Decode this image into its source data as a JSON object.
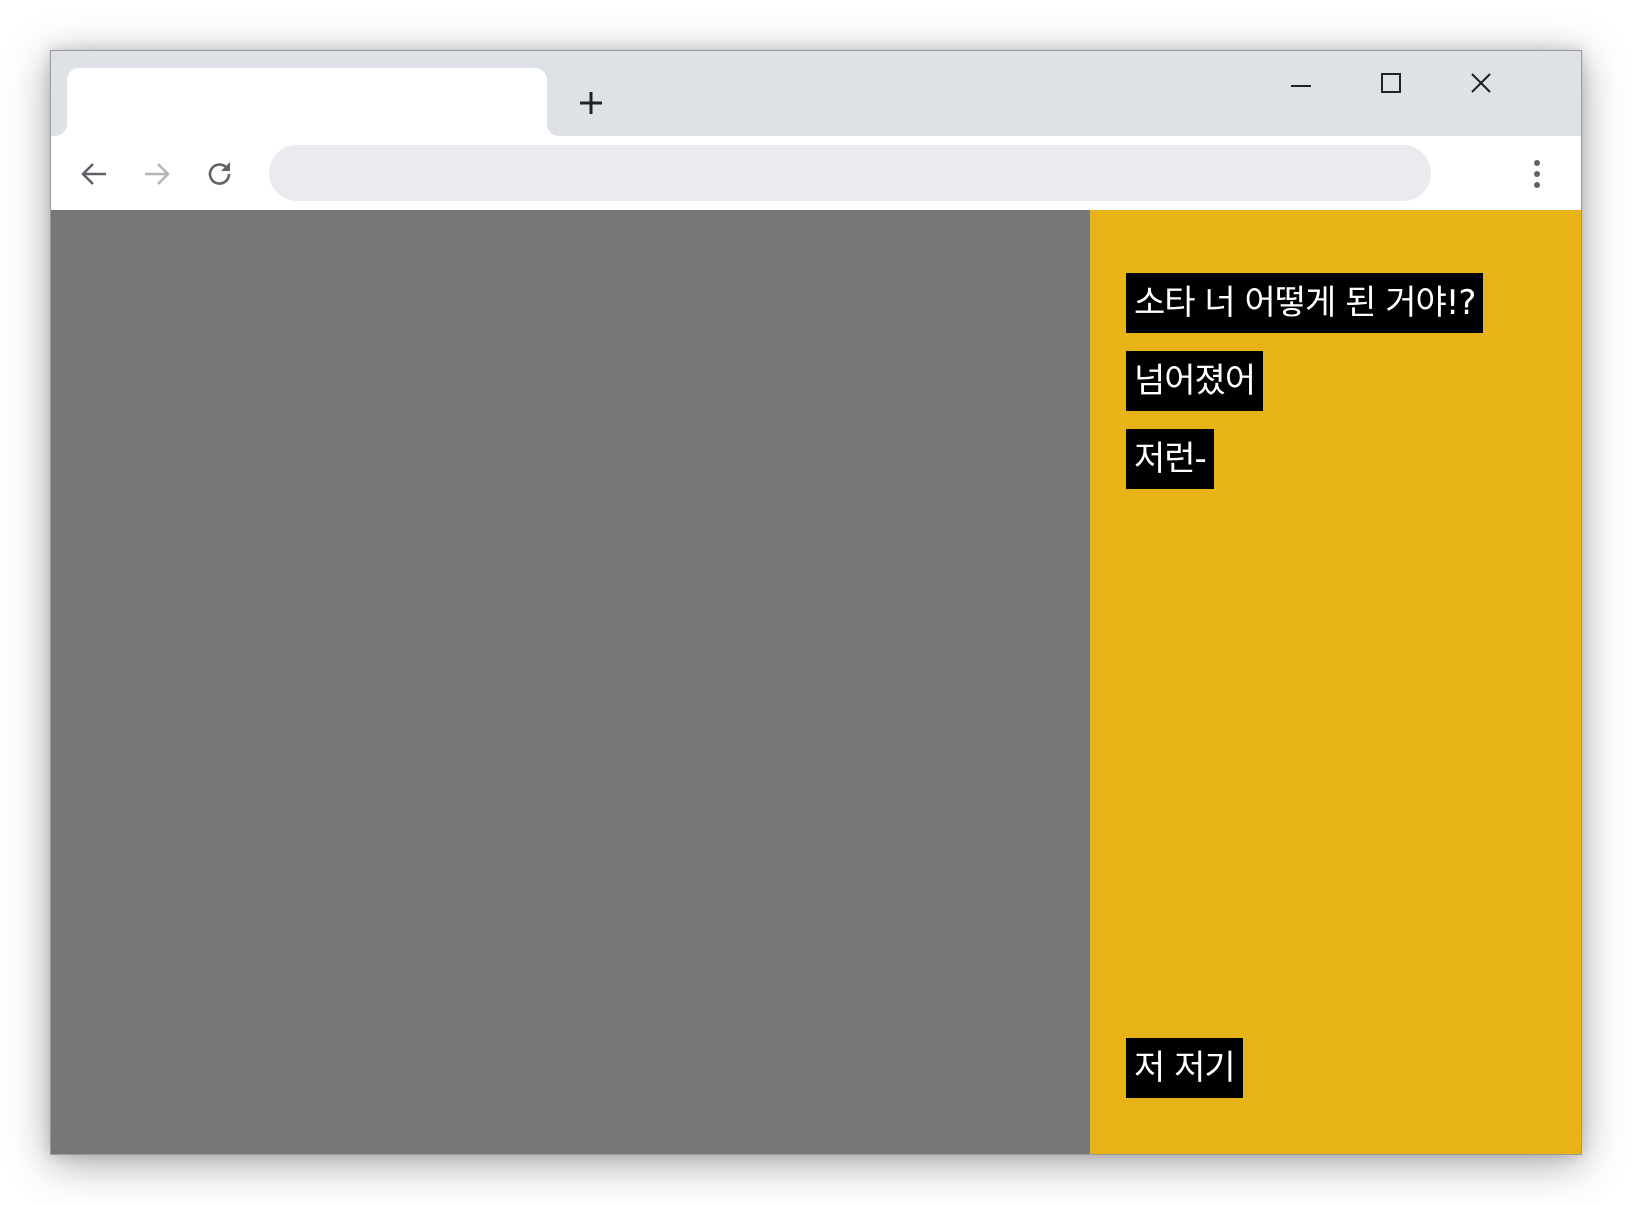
{
  "browser": {
    "tab": {
      "title": ""
    },
    "new_tab_glyph": "+",
    "address_bar": {
      "value": "",
      "placeholder": ""
    }
  },
  "icons": {
    "new_tab": "plus-icon",
    "minimize": "minimize-icon",
    "maximize": "maximize-icon",
    "close": "close-icon",
    "back": "arrow-left-icon",
    "forward": "arrow-right-icon",
    "reload": "reload-icon",
    "menu": "kebab-menu-icon"
  },
  "colors": {
    "tabstrip": "#dee1e6",
    "video_area": "#777777",
    "subtitle_panel": "#e8b316",
    "caption_bg": "#000000",
    "caption_text": "#ffffff"
  },
  "subtitles": [
    {
      "text": "소타 너 어떻게 된 거야!?"
    },
    {
      "text": "넘어졌어"
    },
    {
      "text": "저런-"
    },
    {
      "text": "저 저기"
    }
  ]
}
